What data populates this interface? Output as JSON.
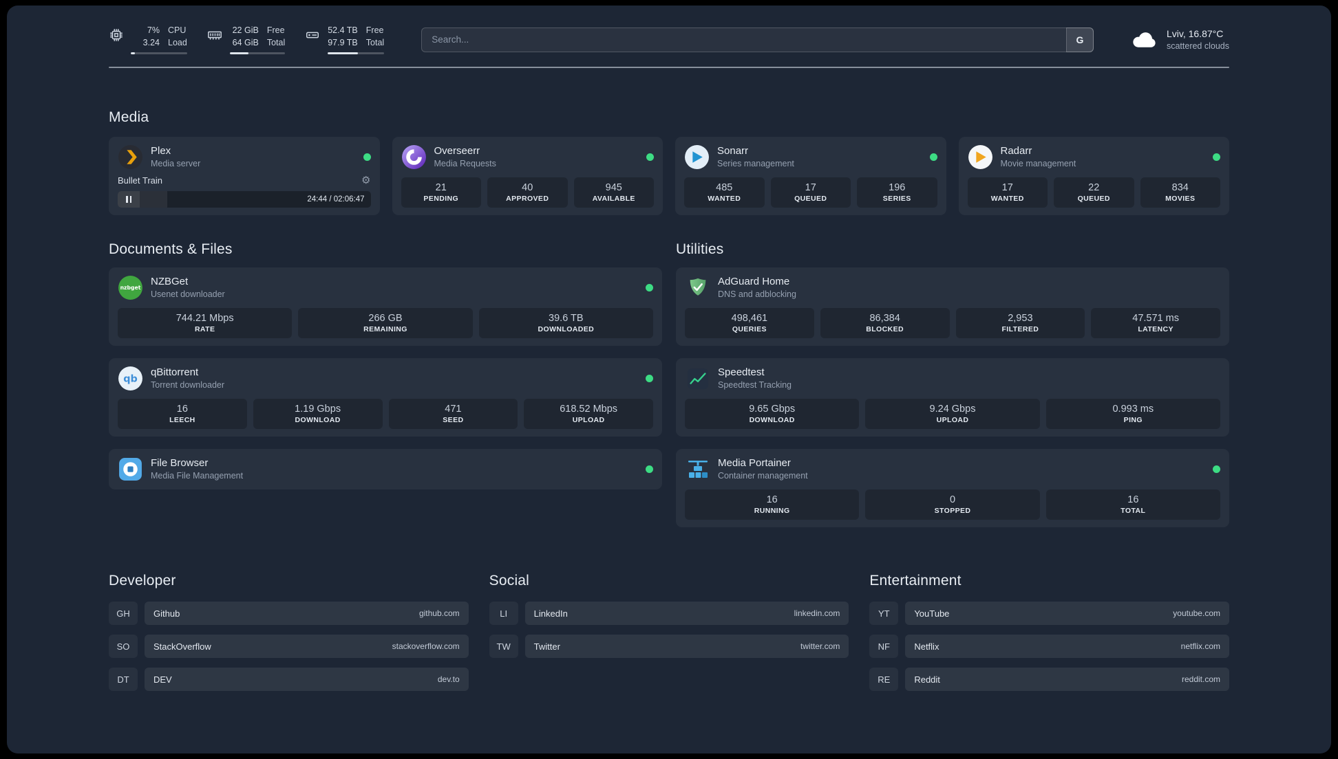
{
  "colors": {
    "page_background": "#1d2635",
    "status_online": "#3ddc84",
    "accent_plex": "#e8a00c",
    "accent_overseerr": "#7c3aed",
    "accent_sonarr": "#2193d1",
    "accent_radarr": "#f0a51f",
    "accent_nzbget": "#40a63f",
    "accent_qbittorrent": "#3f8fd8",
    "accent_adguard": "#67b279",
    "accent_speedtest": "#37d08d",
    "accent_portainer": "#49b0e8",
    "accent_filebrowser": "#52aae8"
  },
  "topbar": {
    "cpu": {
      "icon": "cpu-chip-icon",
      "value_top": "7%",
      "value_bottom": "3.24",
      "label_top": "CPU",
      "label_bottom": "Load",
      "bar_percent": 7
    },
    "memory": {
      "icon": "memory-icon",
      "value_top": "22 GiB",
      "value_bottom": "64 GiB",
      "label_top": "Free",
      "label_bottom": "Total",
      "bar_percent": 34
    },
    "disk": {
      "icon": "disk-icon",
      "value_top": "52.4 TB",
      "value_bottom": "97.9 TB",
      "label_top": "Free",
      "label_bottom": "Total",
      "bar_percent": 54
    },
    "search": {
      "placeholder": "Search...",
      "provider_button": "G"
    },
    "weather": {
      "icon": "cloud-icon",
      "location": "Lviv, 16.87°C",
      "condition": "scattered clouds"
    }
  },
  "sections": {
    "media": {
      "title": "Media",
      "plex": {
        "name": "Plex",
        "subtitle": "Media server",
        "status": "online",
        "player": {
          "title": "Bullet Train",
          "time": "24:44 / 02:06:47",
          "progress_percent": 19.5
        }
      },
      "overseerr": {
        "name": "Overseerr",
        "subtitle": "Media Requests",
        "status": "online",
        "stats": [
          {
            "value": "21",
            "label": "PENDING"
          },
          {
            "value": "40",
            "label": "APPROVED"
          },
          {
            "value": "945",
            "label": "AVAILABLE"
          }
        ]
      },
      "sonarr": {
        "name": "Sonarr",
        "subtitle": "Series management",
        "status": "online",
        "stats": [
          {
            "value": "485",
            "label": "WANTED"
          },
          {
            "value": "17",
            "label": "QUEUED"
          },
          {
            "value": "196",
            "label": "SERIES"
          }
        ]
      },
      "radarr": {
        "name": "Radarr",
        "subtitle": "Movie management",
        "status": "online",
        "stats": [
          {
            "value": "17",
            "label": "WANTED"
          },
          {
            "value": "22",
            "label": "QUEUED"
          },
          {
            "value": "834",
            "label": "MOVIES"
          }
        ]
      }
    },
    "documents": {
      "title": "Documents & Files",
      "nzbget": {
        "name": "NZBGet",
        "subtitle": "Usenet downloader",
        "status": "online",
        "stats": [
          {
            "value": "744.21 Mbps",
            "label": "RATE"
          },
          {
            "value": "266 GB",
            "label": "REMAINING"
          },
          {
            "value": "39.6 TB",
            "label": "DOWNLOADED"
          }
        ]
      },
      "qbittorrent": {
        "name": "qBittorrent",
        "subtitle": "Torrent downloader",
        "status": "online",
        "stats": [
          {
            "value": "16",
            "label": "LEECH"
          },
          {
            "value": "1.19 Gbps",
            "label": "DOWNLOAD"
          },
          {
            "value": "471",
            "label": "SEED"
          },
          {
            "value": "618.52 Mbps",
            "label": "UPLOAD"
          }
        ]
      },
      "filebrowser": {
        "name": "File Browser",
        "subtitle": "Media File Management",
        "status": "online"
      }
    },
    "utilities": {
      "title": "Utilities",
      "adguard": {
        "name": "AdGuard Home",
        "subtitle": "DNS and adblocking",
        "stats": [
          {
            "value": "498,461",
            "label": "QUERIES"
          },
          {
            "value": "86,384",
            "label": "BLOCKED"
          },
          {
            "value": "2,953",
            "label": "FILTERED"
          },
          {
            "value": "47.571 ms",
            "label": "LATENCY"
          }
        ]
      },
      "speedtest": {
        "name": "Speedtest",
        "subtitle": "Speedtest Tracking",
        "stats": [
          {
            "value": "9.65 Gbps",
            "label": "DOWNLOAD"
          },
          {
            "value": "9.24 Gbps",
            "label": "UPLOAD"
          },
          {
            "value": "0.993 ms",
            "label": "PING"
          }
        ]
      },
      "portainer": {
        "name": "Media Portainer",
        "subtitle": "Container management",
        "status": "online",
        "stats": [
          {
            "value": "16",
            "label": "RUNNING"
          },
          {
            "value": "0",
            "label": "STOPPED"
          },
          {
            "value": "16",
            "label": "TOTAL"
          }
        ]
      }
    }
  },
  "bookmarks": {
    "developer": {
      "title": "Developer",
      "items": [
        {
          "abbr": "GH",
          "name": "Github",
          "url": "github.com"
        },
        {
          "abbr": "SO",
          "name": "StackOverflow",
          "url": "stackoverflow.com"
        },
        {
          "abbr": "DT",
          "name": "DEV",
          "url": "dev.to"
        }
      ]
    },
    "social": {
      "title": "Social",
      "items": [
        {
          "abbr": "LI",
          "name": "LinkedIn",
          "url": "linkedin.com"
        },
        {
          "abbr": "TW",
          "name": "Twitter",
          "url": "twitter.com"
        }
      ]
    },
    "entertainment": {
      "title": "Entertainment",
      "items": [
        {
          "abbr": "YT",
          "name": "YouTube",
          "url": "youtube.com"
        },
        {
          "abbr": "NF",
          "name": "Netflix",
          "url": "netflix.com"
        },
        {
          "abbr": "RE",
          "name": "Reddit",
          "url": "reddit.com"
        }
      ]
    }
  }
}
